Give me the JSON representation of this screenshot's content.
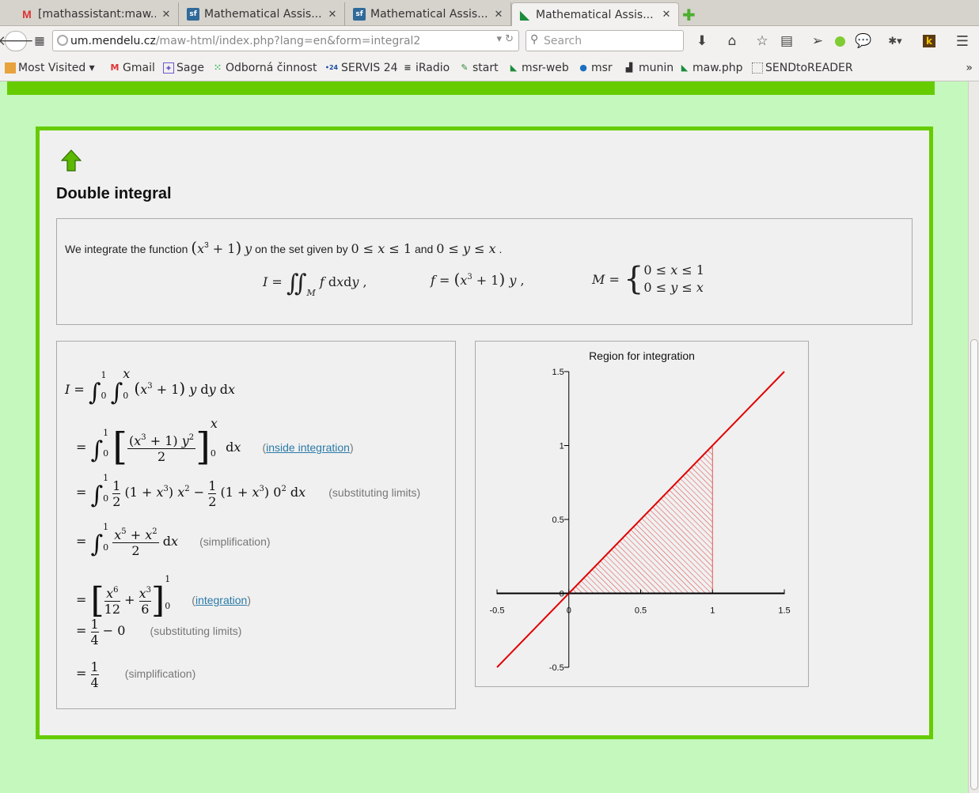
{
  "browser": {
    "tabs": [
      {
        "title": "[mathassistant:maw...",
        "icon": "gmail-icon",
        "active": false
      },
      {
        "title": "Mathematical Assis...",
        "icon": "sf-icon",
        "active": false
      },
      {
        "title": "Mathematical Assis...",
        "icon": "sf-icon",
        "active": false
      },
      {
        "title": "Mathematical Assis...",
        "icon": "mendelu-icon",
        "active": true
      }
    ],
    "url_host": "um.mendelu.cz",
    "url_rest": "/maw-html/index.php?lang=en&form=integral2",
    "search_placeholder": "Search",
    "bookmarks": [
      "Most Visited",
      "Gmail",
      "Sage",
      "Odborná činnost",
      "SERVIS 24",
      "iRadio",
      "start",
      "msr-web",
      "msr",
      "munin",
      "maw.php",
      "SENDtoREADER"
    ]
  },
  "page": {
    "title": "Double integral",
    "statement": {
      "we_integrate": "We integrate the function",
      "on_set": "on the set given by",
      "and": "and"
    },
    "steps": [
      {
        "note": "",
        "link": ""
      },
      {
        "note_pre": "(",
        "link": "inside integration",
        "note_post": ")"
      },
      {
        "note": "(substituting limits)"
      },
      {
        "note": "(simplification)"
      },
      {
        "note_pre": "(",
        "link": "integration",
        "note_post": ")"
      },
      {
        "note": "(substituting limits)"
      },
      {
        "note": "(simplification)"
      }
    ],
    "plot": {
      "title": "Region for integration",
      "xlim": [
        -0.5,
        1.5
      ],
      "ylim": [
        -0.5,
        1.5
      ],
      "x_ticks": [
        "-0.5",
        "0",
        "0.5",
        "1",
        "1.5"
      ],
      "y_ticks": [
        "1.5",
        "1",
        "0.5",
        "0",
        "-0.5"
      ],
      "line_color": "#e00000",
      "hatch_color": "#e04040"
    }
  }
}
